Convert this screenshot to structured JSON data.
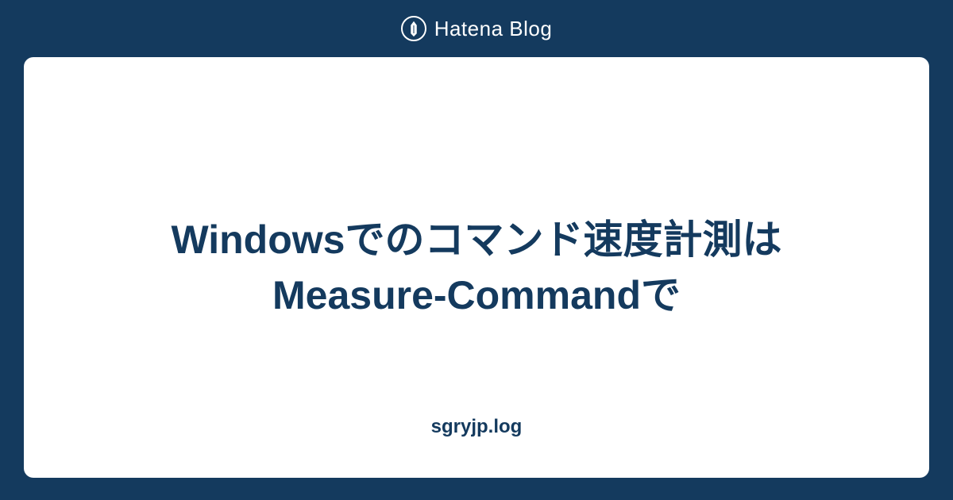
{
  "header": {
    "brand_text": "Hatena Blog",
    "icon_name": "pen-icon"
  },
  "card": {
    "title": "Windowsでのコマンド速度計測はMeasure-Commandで",
    "blog_name": "sgryjp.log"
  },
  "colors": {
    "background": "#143a5e",
    "card_bg": "#ffffff",
    "text_primary": "#143a5e",
    "header_text": "#ffffff"
  }
}
